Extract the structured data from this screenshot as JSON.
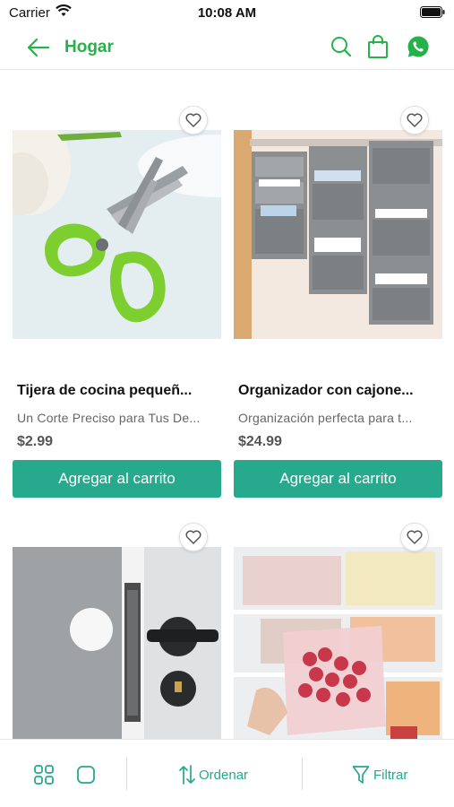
{
  "status_bar": {
    "carrier": "Carrier",
    "time": "10:08 AM"
  },
  "nav": {
    "title": "Hogar"
  },
  "products": [
    {
      "title": "Tijera de cocina pequeñ...",
      "description": "Un Corte Preciso para Tus De...",
      "price": "$2.99",
      "button_label": "Agregar al carrito",
      "image": "green kitchen scissors"
    },
    {
      "title": "Organizador con cajone...",
      "description": "Organización perfecta para t...",
      "price": "$24.99",
      "button_label": "Agregar al carrito",
      "image": "hanging closet organizer"
    },
    {
      "title": "",
      "description": "",
      "price": "",
      "button_label": "",
      "image": "door stopper"
    },
    {
      "title": "",
      "description": "",
      "price": "",
      "button_label": "",
      "image": "refrigerator storage bags"
    }
  ],
  "bottom_bar": {
    "sort_label": "Ordenar",
    "filter_label": "Filtrar"
  },
  "colors": {
    "brand_green": "#26b24a",
    "button_teal": "#27a98e",
    "accent_teal": "#26a88c"
  }
}
